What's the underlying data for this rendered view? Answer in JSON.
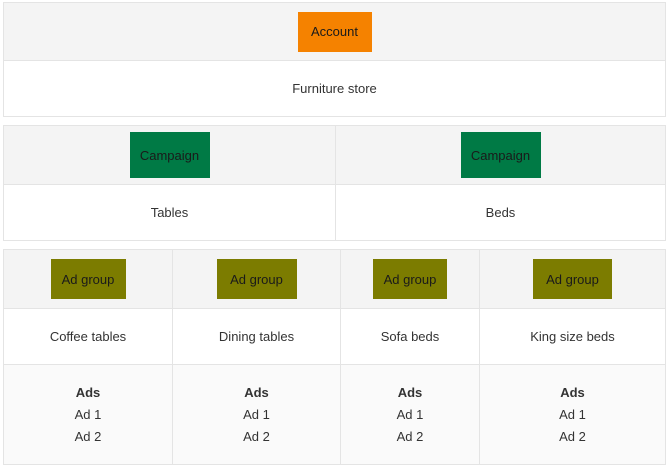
{
  "colors": {
    "account": "#f58200",
    "campaign": "#007a45",
    "adgroup": "#7c7c00"
  },
  "account": {
    "label": "Account",
    "name": "Furniture store"
  },
  "campaigns": [
    {
      "label": "Campaign",
      "name": "Tables"
    },
    {
      "label": "Campaign",
      "name": "Beds"
    }
  ],
  "adgroups": [
    {
      "label": "Ad group",
      "name": "Coffee tables",
      "ads_title": "Ads",
      "ads": [
        "Ad 1",
        "Ad 2"
      ]
    },
    {
      "label": "Ad group",
      "name": "Dining tables",
      "ads_title": "Ads",
      "ads": [
        "Ad 1",
        "Ad 2"
      ]
    },
    {
      "label": "Ad group",
      "name": "Sofa beds",
      "ads_title": "Ads",
      "ads": [
        "Ad 1",
        "Ad 2"
      ]
    },
    {
      "label": "Ad group",
      "name": "King size beds",
      "ads_title": "Ads",
      "ads": [
        "Ad 1",
        "Ad 2"
      ]
    }
  ]
}
